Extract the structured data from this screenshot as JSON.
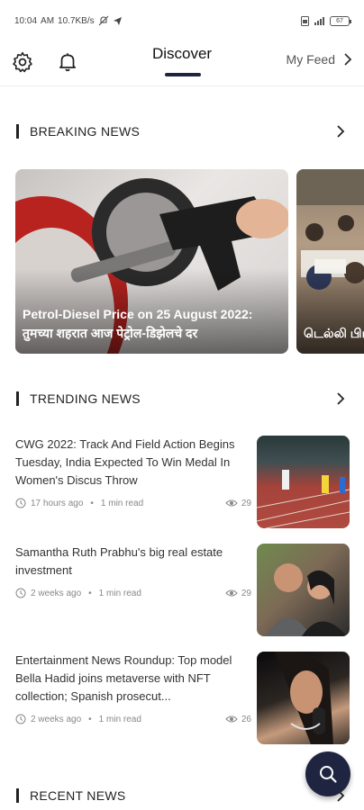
{
  "status_bar": {
    "time": "10:04",
    "ampm": "AM",
    "net_speed": "10.7KB/s",
    "battery": "67"
  },
  "nav": {
    "tabs": [
      {
        "label": "Discover",
        "active": true
      },
      {
        "label": "My Feed",
        "active": false
      }
    ],
    "accent": "#1f2540"
  },
  "sections": {
    "breaking": {
      "title": "BREAKING NEWS",
      "cards": [
        {
          "title": "Petrol-Diesel Price on 25 August 2022: तुमच्या शहरात आज पेट्रोल-डिझेलचे दर"
        },
        {
          "title": "டெல்லி பிடித்த"
        }
      ]
    },
    "trending": {
      "title": "TRENDING NEWS",
      "items": [
        {
          "title": "CWG 2022: Track And Field Action Begins Tuesday, India Expected To Win Medal In Women's Discus Throw",
          "time": "17 hours ago",
          "read": "1 min read",
          "views": "29"
        },
        {
          "title": "Samantha Ruth Prabhu's big real estate investment",
          "time": "2 weeks ago",
          "read": "1 min read",
          "views": "29"
        },
        {
          "title": "Entertainment News Roundup: Top model Bella Hadid joins metaverse with NFT collection; Spanish prosecut...",
          "time": "2 weeks ago",
          "read": "1 min read",
          "views": "26"
        }
      ]
    },
    "recent": {
      "title": "RECENT NEWS"
    }
  },
  "icons": {
    "settings": "gear-icon",
    "notifications": "bell-icon",
    "search": "search-icon",
    "clock": "clock-icon",
    "views": "eye-icon",
    "chevron": "chevron-right-icon"
  }
}
